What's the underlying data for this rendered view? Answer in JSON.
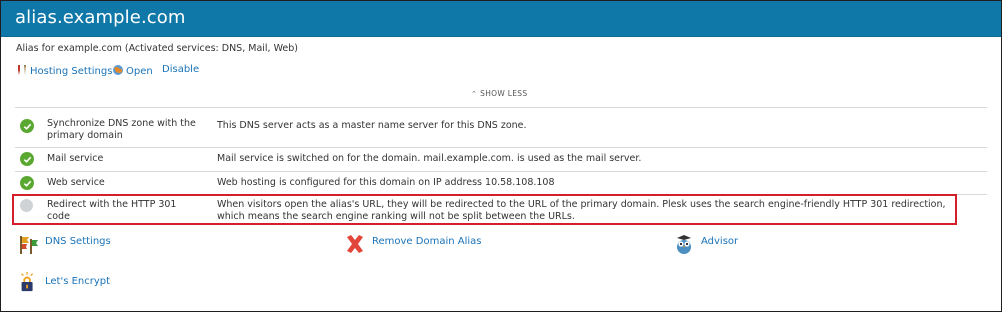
{
  "header": {
    "title": "alias.example.com"
  },
  "subtitle": "Alias for example.com (Activated services: DNS, Mail, Web)",
  "actions": [
    {
      "label": "Hosting Settings",
      "icon": "wrench-icon"
    },
    {
      "label": "Open",
      "icon": "globe-icon"
    },
    {
      "label": "Disable"
    }
  ],
  "toggle": {
    "label": "SHOW LESS"
  },
  "services": [
    {
      "name": "Synchronize DNS zone with the primary domain",
      "status": "on",
      "description": "This DNS server acts as a master name server for this DNS zone."
    },
    {
      "name": "Mail service",
      "status": "on",
      "description": "Mail service is switched on for the domain. mail.example.com. is used as the mail server."
    },
    {
      "name": "Web service",
      "status": "on",
      "description": "Web hosting is configured for this domain on IP address 10.58.108.108"
    },
    {
      "name": "Redirect with the HTTP 301 code",
      "status": "off",
      "description": "When visitors open the alias's URL, they will be redirected to the URL of the primary domain. Plesk uses the search engine-friendly HTTP 301 redirection, which means the search engine ranking will not be split between the URLs."
    }
  ],
  "tools": [
    {
      "label": "DNS Settings",
      "icon": "dns-flags-icon"
    },
    {
      "label": "Remove Domain Alias",
      "icon": "red-x-icon"
    },
    {
      "label": "Advisor",
      "icon": "owl-icon"
    },
    {
      "label": "Let's Encrypt",
      "icon": "padlock-icon"
    }
  ],
  "colors": {
    "header": "#0f78a8",
    "link": "#1a73b8",
    "ok": "#5aa832",
    "highlight": "#d41f2a"
  }
}
